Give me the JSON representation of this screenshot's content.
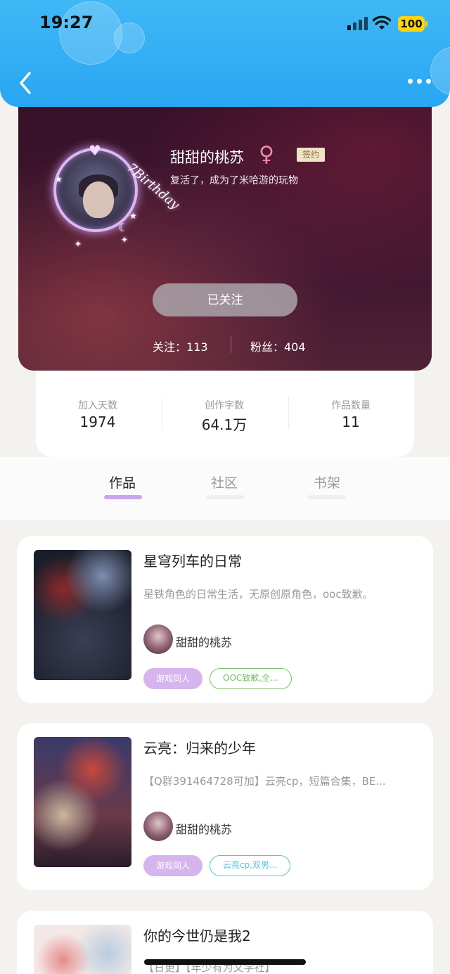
{
  "status_bar": {
    "time": "19:27",
    "battery": "100"
  },
  "header": {
    "back_icon": "chevron-left-icon",
    "more_icon": "more-dots-icon"
  },
  "profile": {
    "username": "甜甜的桃苏",
    "gender_icon": "female-icon",
    "gender_symbol": "♀",
    "signed_badge": "签约",
    "bio": "复活了，成为了米哈游的玩物",
    "follow_button": "已关注",
    "following_label": "关注：113",
    "fans_label": "粉丝：404",
    "avatar_frame_text": "7Birthday"
  },
  "stats": [
    {
      "label": "加入天数",
      "value": "1974"
    },
    {
      "label": "创作字数",
      "value": "64.1万"
    },
    {
      "label": "作品数量",
      "value": "11"
    }
  ],
  "tabs": [
    {
      "label": "作品",
      "active": true
    },
    {
      "label": "社区",
      "active": false
    },
    {
      "label": "书架",
      "active": false
    }
  ],
  "colors": {
    "accent": "#29a6f3",
    "tab_active_underline": "#c9a6ec",
    "tag_purple": "#d6b5ee"
  },
  "books": [
    {
      "title": "星穹列车的日常",
      "description": "星铁角色的日常生活，无原创原角色，ooc致歉。",
      "author": "甜甜的桃苏",
      "tag1": "游戏同人",
      "tag2": "OOC致歉,全...",
      "tag2_color": "#7bbf6a"
    },
    {
      "title": "云亮：归来的少年",
      "description": "【Q群391464728可加】云亮cp，短篇合集，BE...",
      "author": "甜甜的桃苏",
      "tag1": "游戏同人",
      "tag2": "云亮cp,双男...",
      "tag2_color": "#4fc3e0"
    },
    {
      "title": "你的今世仍是我2",
      "description": "【日更】【年少有为文学社】"
    }
  ]
}
